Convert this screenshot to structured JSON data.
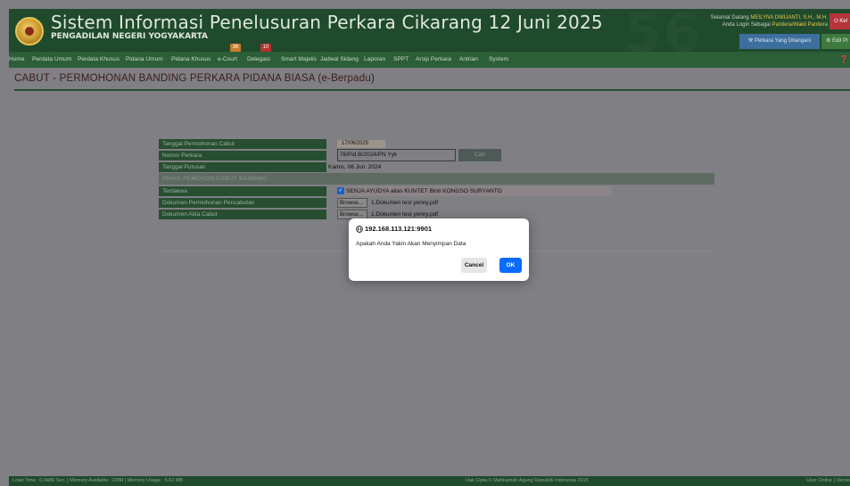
{
  "header": {
    "title": "Sistem Informasi Penelusuran Perkara Cikarang 12 Juni 2025",
    "subtitle": "PENGADILAN NEGERI YOGYAKARTA",
    "watermark": "56",
    "welcome_prefix": "Selamat Datang",
    "welcome_user": "MEILYNA DWIJANTI, S.H., M.H.",
    "login_prefix": "Anda Login Sebagai",
    "login_role": "Panitera/Wakil Panitera",
    "logout_label": "Kel",
    "perkara_button": "Perkara Yang Ditangani",
    "edit_button": "Edit Pr"
  },
  "nav": {
    "items": [
      "Home",
      "Perdata Umum",
      "Perdata Khusus",
      "Pidana Umum",
      "Pidana Khusus",
      "e-Court",
      "Delegasi",
      "Smart Majelis",
      "Jadwal Sidang",
      "Laporan",
      "SPPT",
      "Arsip Perkara",
      "Antrian",
      "System"
    ],
    "badges": {
      "ecourt": "36",
      "delegasi": "10"
    }
  },
  "page": {
    "heading": "CABUT - PERMOHONAN BANDING PERKARA PIDANA BIASA (e-Berpadu)"
  },
  "form": {
    "tanggal_permohonan_label": "Tanggal Permohonan Cabut",
    "tanggal_permohonan_value": "17/06/2025",
    "nomor_perkara_label": "Nomor Perkara",
    "nomor_perkara_value": "76/Pid.B/2024/PN Yyk",
    "cari_label": "Cari",
    "tanggal_putusan_label": "Tanggal Putusan",
    "tanggal_putusan_value": "Kamis, 06 Jun. 2024",
    "section_title": "PIHAK PEMOHON CABUT BANDING",
    "terdakwa_label": "Terdakwa",
    "terdakwa_value": "SENJA AYUDYA alias KUNTET Binti KONGSO SURYANTO",
    "dokumen_pencabutan_label": "Dokumen Permohonan Pencabutan",
    "dokumen_akta_label": "Dokumen Akta Cabut",
    "browse_label": "Browse...",
    "file_pencabutan": "1.Dokumen test yenny.pdf",
    "file_akta": "1.Dokumen test yenny.pdf"
  },
  "footer": {
    "left": "Load Time : 0.0489 Sec. | Memory Available: 128M | Memory Usage : 5.62 MB",
    "center": "Hak Cipta © Mahkamah Agung Republik Indonesia 2015",
    "right": "User Online | Versio"
  },
  "dialog": {
    "origin": "192.168.113.121:9901",
    "message": "Apakah Anda Yakin Akan Menyimpan Data",
    "cancel_label": "Cancel",
    "ok_label": "OK"
  },
  "colors": {
    "header_bg": "#1f4a2c",
    "nav_bg": "#2c5f38",
    "overlay": "#7f7f84",
    "ok_button": "#0a6cff",
    "logout_button": "#b5343a"
  }
}
